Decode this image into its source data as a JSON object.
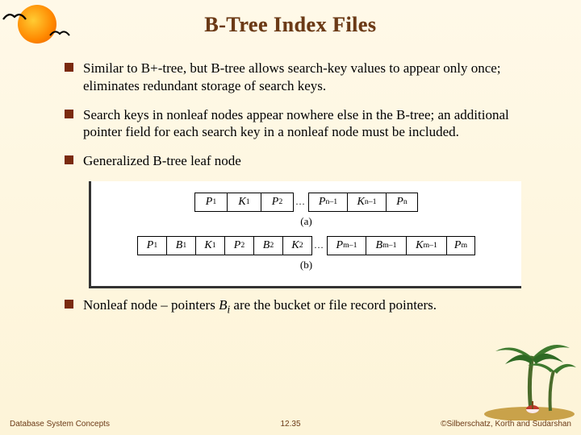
{
  "title": "B-Tree Index Files",
  "bullets": {
    "b1": "Similar to B+-tree, but B-tree allows search-key values to appear only once; eliminates redundant storage of search keys.",
    "b2": "Search keys in nonleaf nodes appear nowhere else in the B-tree; an additional pointer field for each search key in a nonleaf node must be included.",
    "b3": "Generalized B-tree leaf node",
    "b4_pre": "Nonleaf node – pointers ",
    "b4_var": "B",
    "b4_sub": "i",
    "b4_post": " are the bucket or file record pointers."
  },
  "diagram": {
    "rowA": {
      "cells": [
        "P₁",
        "K₁",
        "P₂",
        "…",
        "Pₙ₋₁",
        "Kₙ₋₁",
        "Pₙ"
      ],
      "label": "(a)"
    },
    "rowB": {
      "cells": [
        "P₁",
        "B₁",
        "K₁",
        "P₂",
        "B₂",
        "K₂",
        "…",
        "Pₘ₋₁",
        "Bₘ₋₁",
        "Kₘ₋₁",
        "Pₘ"
      ],
      "label": "(b)"
    }
  },
  "footer": {
    "left": "Database System Concepts",
    "mid": "12.35",
    "right": "©Silberschatz, Korth and Sudarshan"
  }
}
